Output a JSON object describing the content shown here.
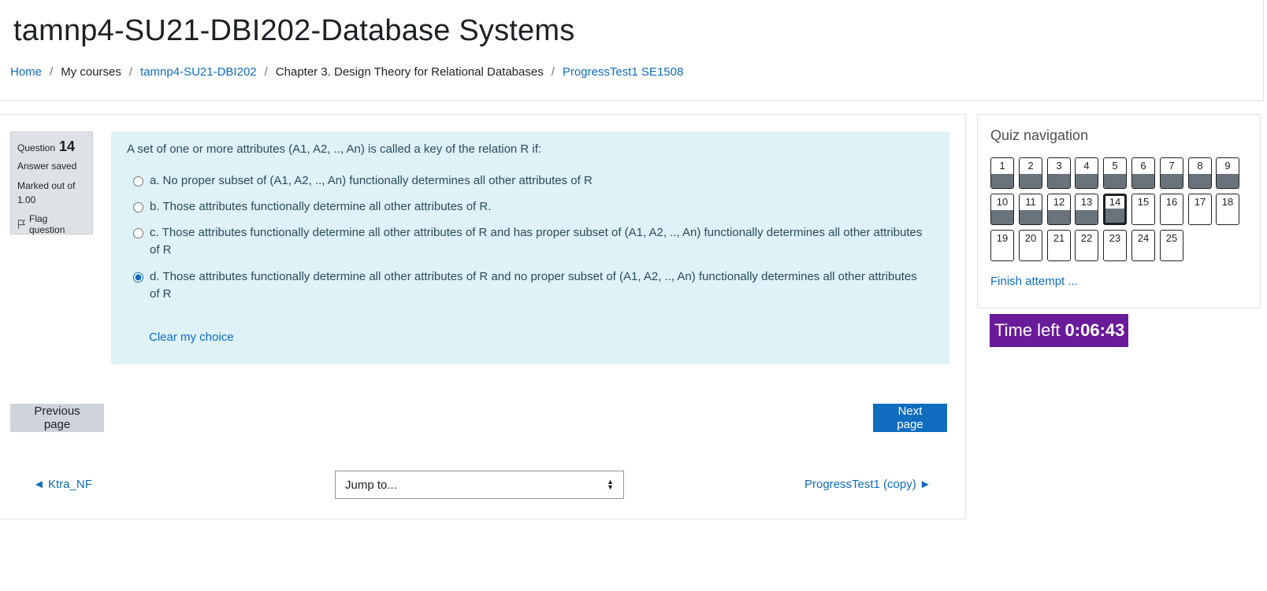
{
  "header": {
    "title": "tamnp4-SU21-DBI202-Database Systems",
    "breadcrumb": {
      "home": "Home",
      "my_courses": "My courses",
      "course": "tamnp4-SU21-DBI202",
      "chapter": "Chapter 3. Design Theory for Relational Databases",
      "quiz": "ProgressTest1 SE1508",
      "separator": "/"
    }
  },
  "question_info": {
    "question_label": "Question",
    "question_number": "14",
    "state": "Answer saved",
    "grade": "Marked out of 1.00",
    "flag_label": "Flag question"
  },
  "question": {
    "text": "A set of one or more attributes (A1, A2, .., An) is called a key of the relation R if:",
    "answers": [
      {
        "letter": "a.",
        "text": "No proper subset of (A1, A2, .., An) functionally determines all other attributes of R",
        "selected": false
      },
      {
        "letter": "b.",
        "text": "Those attributes functionally determine all other attributes of R.",
        "selected": false
      },
      {
        "letter": "c.",
        "text": "Those attributes functionally determine all other attributes of R and has proper subset of (A1, A2, .., An) functionally determines all other attributes of R",
        "selected": false
      },
      {
        "letter": "d.",
        "text": "Those attributes functionally determine all other attributes of R and no proper subset of (A1, A2, .., An) functionally determines all other attributes of R",
        "selected": true
      }
    ],
    "clear_choice": "Clear my choice"
  },
  "nav_buttons": {
    "previous": "Previous page",
    "next": "Next page"
  },
  "activity_nav": {
    "prev_link": "◄ Ktra_NF",
    "jump_placeholder": "Jump to...",
    "next_link": "ProgressTest1 (copy) ►"
  },
  "quiz_navigation": {
    "title": "Quiz navigation",
    "questions": [
      {
        "num": "1",
        "answered": true
      },
      {
        "num": "2",
        "answered": true
      },
      {
        "num": "3",
        "answered": true
      },
      {
        "num": "4",
        "answered": true
      },
      {
        "num": "5",
        "answered": true
      },
      {
        "num": "6",
        "answered": true
      },
      {
        "num": "7",
        "answered": true
      },
      {
        "num": "8",
        "answered": true
      },
      {
        "num": "9",
        "answered": true
      },
      {
        "num": "10",
        "answered": true
      },
      {
        "num": "11",
        "answered": true
      },
      {
        "num": "12",
        "answered": true
      },
      {
        "num": "13",
        "answered": true
      },
      {
        "num": "14",
        "answered": true,
        "current": true
      },
      {
        "num": "15",
        "answered": false
      },
      {
        "num": "16",
        "answered": false
      },
      {
        "num": "17",
        "answered": false
      },
      {
        "num": "18",
        "answered": false
      },
      {
        "num": "19",
        "answered": false
      },
      {
        "num": "20",
        "answered": false
      },
      {
        "num": "21",
        "answered": false
      },
      {
        "num": "22",
        "answered": false
      },
      {
        "num": "23",
        "answered": false
      },
      {
        "num": "24",
        "answered": false
      },
      {
        "num": "25",
        "answered": false
      }
    ],
    "finish_link": "Finish attempt ..."
  },
  "timer": {
    "label": "Time left",
    "value": "0:06:43"
  },
  "colors": {
    "link": "#0f6cbf",
    "question_bg": "#def2f8",
    "timer_bg": "#6a1b9a",
    "answered_fill": "#6a737b"
  }
}
